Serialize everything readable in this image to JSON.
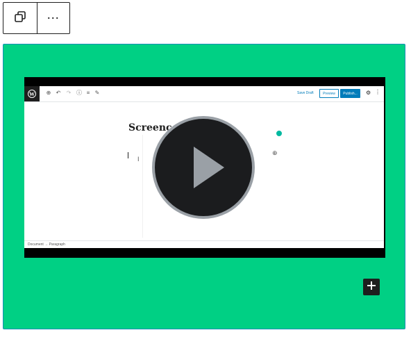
{
  "toolbar": {
    "transform_icon": "block-transform-icon",
    "more_label": "⋯"
  },
  "video": {
    "screen": {
      "save_draft": "Save Draft",
      "preview": "Preview",
      "publish": "Publish...",
      "title": "Screenc",
      "footer_breadcrumb": "Document → Paragraph"
    },
    "play_icon": "play-icon"
  },
  "inserter": {
    "icon": "plus-icon",
    "label": "+"
  },
  "colors": {
    "group_background": "#00d084",
    "group_border": "#1a8fb8",
    "play_button": "#1b1c1e",
    "play_ring": "#9aa0a6",
    "accent": "#007cba"
  }
}
